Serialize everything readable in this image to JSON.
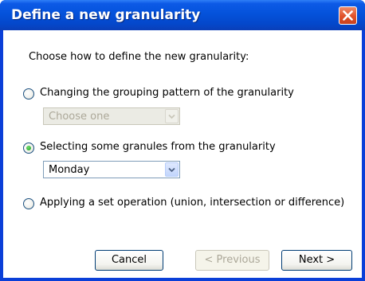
{
  "window": {
    "title": "Define a new granularity",
    "close_icon": "close-icon"
  },
  "dialog": {
    "prompt": "Choose how to define the new granularity:",
    "options": [
      {
        "label": "Changing the grouping pattern of the granularity",
        "selected": false
      },
      {
        "label": "Selecting some granules from the granularity",
        "selected": true
      },
      {
        "label": "Applying a set operation (union, intersection or difference)",
        "selected": false
      }
    ],
    "grouping_select": {
      "value": "Choose one",
      "enabled": false
    },
    "granule_select": {
      "value": "Monday",
      "enabled": true
    }
  },
  "buttons": {
    "cancel": "Cancel",
    "previous": "< Previous",
    "next": "Next >"
  },
  "colors": {
    "titlebar": "#0452db",
    "close_button": "#e0512a",
    "radio_selected_dot": "#21a121"
  }
}
